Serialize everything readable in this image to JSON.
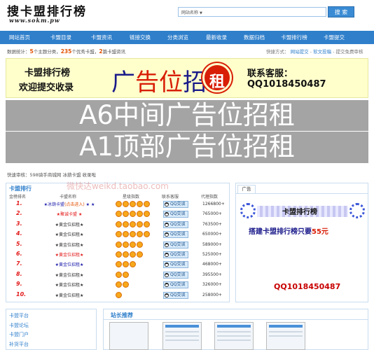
{
  "header": {
    "logo_main": "搜卡盟排行榜",
    "logo_sub": "www.sokm.pw",
    "search_select": "网站名称",
    "search_button": "搜 索"
  },
  "nav": [
    "网站首页",
    "卡盟目录",
    "卡盟资讯",
    "链接交换",
    "分类浏览",
    "最新收录",
    "数据归档",
    "卡盟排行榜",
    "卡盟提交"
  ],
  "stats": {
    "prefix": "数据统计：",
    "cat_count": "5",
    "cat_label": "个主题分类，",
    "site_count": "235",
    "site_label": "个优秀卡盟，",
    "news_count": "2",
    "news_label": "篇卡盟资讯"
  },
  "quick": {
    "label": "快捷方式：",
    "links": [
      "网站提交",
      "软文投稿",
      "提交免费审核"
    ]
  },
  "top_ad": {
    "line1": "卡盟排行榜",
    "line2": "欢迎提交收录",
    "mid_a": "广",
    "mid_b": "告位",
    "mid_c": "招",
    "seal": "租",
    "contact": "联系客服：QQ1018450487"
  },
  "gray_ads": [
    "A6中间广告位招租",
    "A1顶部广告位招租"
  ],
  "audit": "快速审核：598骑手商城网    冰葫卡盟    收录啦",
  "watermark": "微快达weikd.taobao.com",
  "ranking": {
    "title": "卡盟排行",
    "headers": [
      "金榜排名",
      "卡盟名称",
      "星级指数",
      "联系客服",
      "代理指数"
    ],
    "qq_label": "QQ交谈",
    "rows": [
      {
        "no": "1.",
        "name": "★冰葫卡盟",
        "sub": "(点击进入)",
        "tail": " ★ ★",
        "style": "blue",
        "suns": 5,
        "traffic": "1266800+"
      },
      {
        "no": "2.",
        "name": "★聚诚卡盟 ★",
        "sub": "",
        "tail": "",
        "style": "red",
        "suns": 5,
        "traffic": "765000+"
      },
      {
        "no": "3.",
        "name": "★黄金位招租★",
        "sub": "",
        "tail": "",
        "style": "dark",
        "suns": 5,
        "traffic": "763500+"
      },
      {
        "no": "4.",
        "name": "★黄金位招租★",
        "sub": "",
        "tail": "",
        "style": "dark",
        "suns": 5,
        "traffic": "650000+"
      },
      {
        "no": "5.",
        "name": "★黄金位招租★",
        "sub": "",
        "tail": "",
        "style": "dark",
        "suns": 4,
        "traffic": "589000+"
      },
      {
        "no": "6.",
        "name": "★黄金位招租★",
        "sub": "",
        "tail": "",
        "style": "red",
        "suns": 4,
        "traffic": "525000+"
      },
      {
        "no": "7.",
        "name": "★黄金位招租★",
        "sub": "",
        "tail": "",
        "style": "blue",
        "suns": 3,
        "traffic": "468000+"
      },
      {
        "no": "8.",
        "name": "★黄金位招租★",
        "sub": "",
        "tail": "",
        "style": "dark",
        "suns": 2,
        "traffic": "395500+"
      },
      {
        "no": "9.",
        "name": "★黄金位招租★",
        "sub": "",
        "tail": "",
        "style": "dark",
        "suns": 2,
        "traffic": "326000+"
      },
      {
        "no": "10.",
        "name": "★黄金位招租★",
        "sub": "",
        "tail": "",
        "style": "dark",
        "suns": 1,
        "traffic": "258000+"
      }
    ]
  },
  "side_ad": {
    "tab": "广告",
    "title": "卡盟排行榜",
    "sub_a": "搭建卡盟排行榜只要",
    "sub_b": "55元",
    "contact": "QQ1018450487"
  },
  "categories": [
    "卡盟平台",
    "卡盟论坛",
    "卡盟门户",
    "补货平台"
  ],
  "recommend": {
    "title": "站长推荐"
  }
}
